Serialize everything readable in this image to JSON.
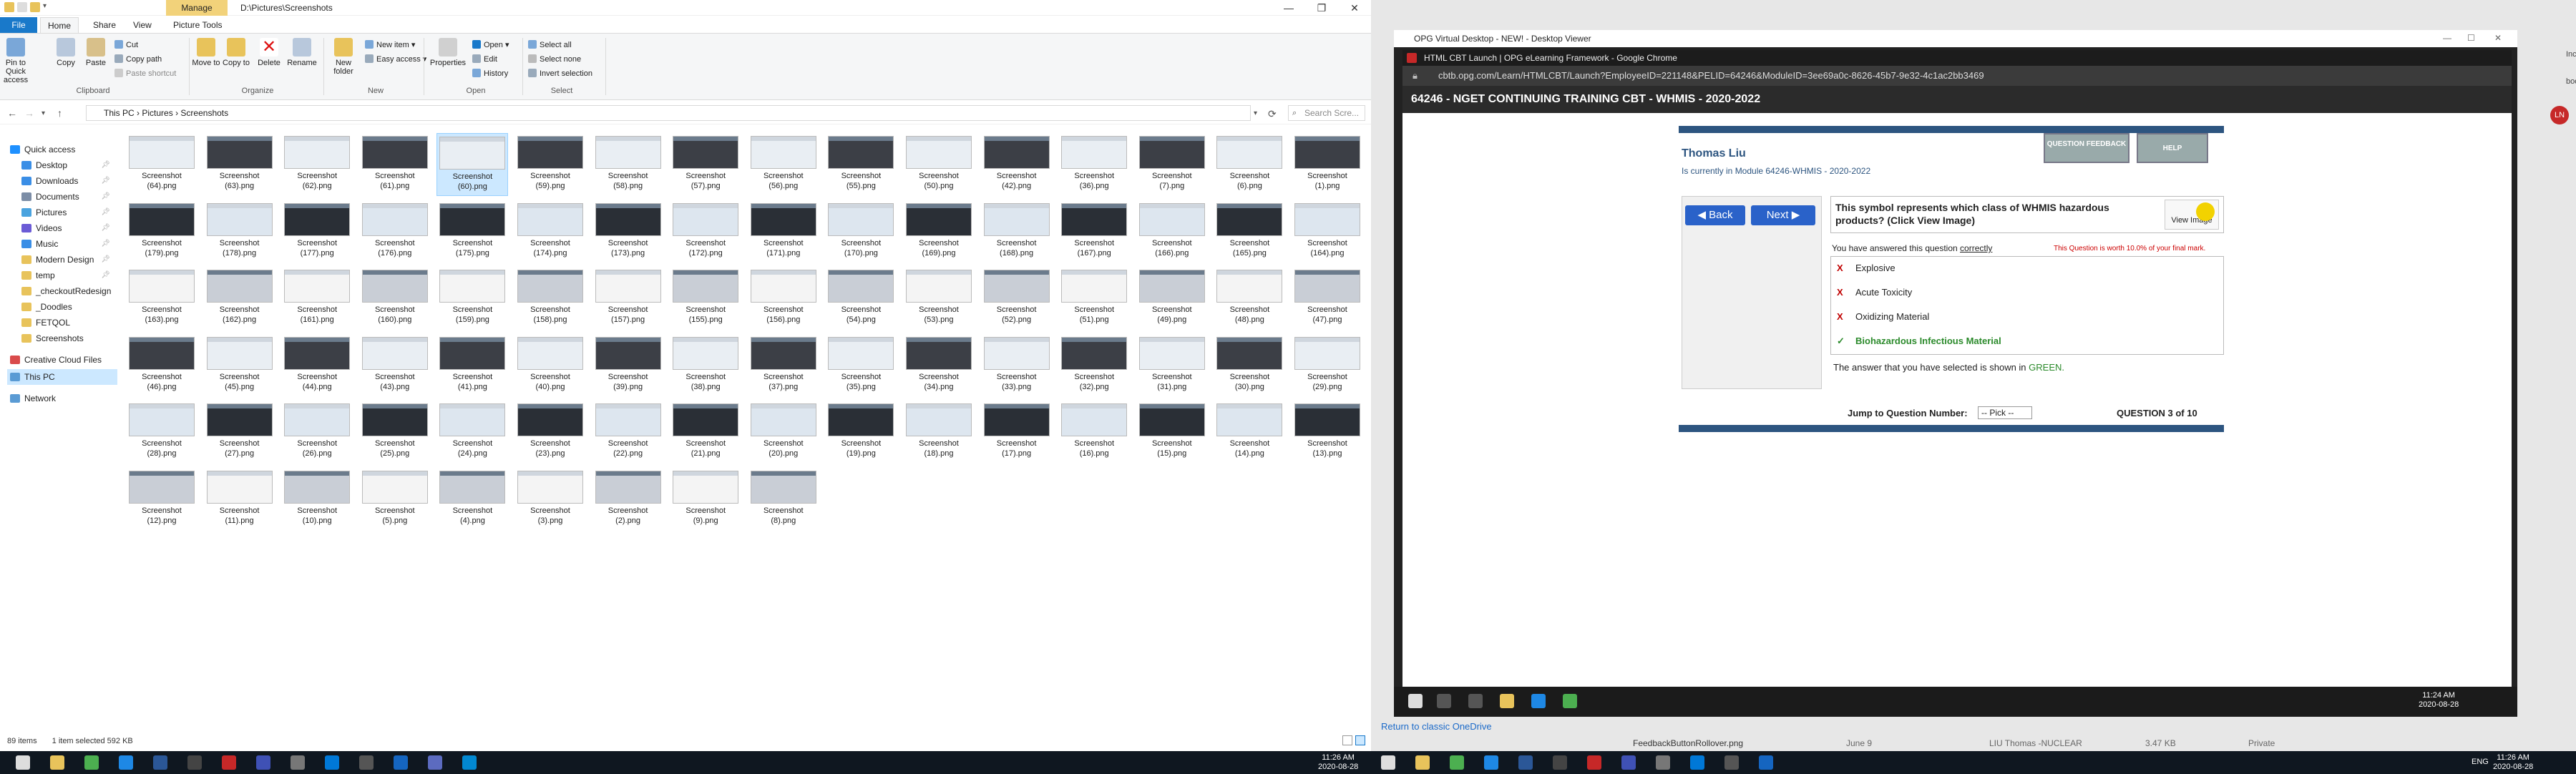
{
  "explorer": {
    "manage_tab": "Manage",
    "path": "D:\\Pictures\\Screenshots",
    "tabs": [
      "File",
      "Home",
      "Share",
      "View",
      "Picture Tools"
    ],
    "ribbon": {
      "pin": "Pin to Quick access",
      "copy": "Copy",
      "paste": "Paste",
      "cut": "Cut",
      "copy_path": "Copy path",
      "paste_shortcut": "Paste shortcut",
      "move_to": "Move to",
      "copy_to": "Copy to",
      "delete": "Delete",
      "rename": "Rename",
      "new_folder": "New folder",
      "new_item": "New item",
      "easy_access": "Easy access",
      "properties": "Properties",
      "open": "Open",
      "edit": "Edit",
      "history": "History",
      "select_all": "Select all",
      "select_none": "Select none",
      "invert_selection": "Invert selection",
      "groups": [
        "Clipboard",
        "Organize",
        "New",
        "Open",
        "Select"
      ]
    },
    "breadcrumb": [
      "This PC",
      "Pictures",
      "Screenshots"
    ],
    "search_placeholder": "Search Scre...",
    "nav": [
      {
        "label": "Quick access",
        "pin": false,
        "color": "#1e90ff"
      },
      {
        "label": "Desktop",
        "pin": true,
        "color": "#3a8ee6"
      },
      {
        "label": "Downloads",
        "pin": true,
        "color": "#3a8ee6"
      },
      {
        "label": "Documents",
        "pin": true,
        "color": "#7c8da6"
      },
      {
        "label": "Pictures",
        "pin": true,
        "color": "#4aa3df"
      },
      {
        "label": "Videos",
        "pin": true,
        "color": "#6b5bd6"
      },
      {
        "label": "Music",
        "pin": true,
        "color": "#3a8ee6"
      },
      {
        "label": "Modern Design",
        "pin": true,
        "color": "#e8c35b"
      },
      {
        "label": "temp",
        "pin": true,
        "color": "#e8c35b"
      },
      {
        "label": "_checkoutRedesign",
        "pin": false,
        "color": "#e8c35b"
      },
      {
        "label": "_Doodles",
        "pin": false,
        "color": "#e8c35b"
      },
      {
        "label": "FETQOL",
        "pin": false,
        "color": "#e8c35b"
      },
      {
        "label": "Screenshots",
        "pin": false,
        "color": "#e8c35b"
      },
      {
        "label": "Creative Cloud Files",
        "pin": false,
        "color": "#d94b4b"
      },
      {
        "label": "This PC",
        "pin": false,
        "color": "#5a9bd4"
      },
      {
        "label": "Network",
        "pin": false,
        "color": "#5a9bd4"
      }
    ],
    "files": [
      [
        "(64)",
        "(63)",
        "(62)",
        "(61)",
        "(60)",
        "(59)",
        "(58)",
        "(57)",
        "(56)",
        "(55)",
        "(50)",
        "(42)",
        "(36)",
        "(7)",
        "(6)",
        "(1)"
      ],
      [
        "(179)",
        "(178)",
        "(177)",
        "(176)",
        "(175)",
        "(174)",
        "(173)",
        "(172)",
        "(171)",
        "(170)",
        "(169)",
        "(168)",
        "(167)",
        "(166)",
        "(165)",
        "(164)"
      ],
      [
        "(163)",
        "(162)",
        "(161)",
        "(160)",
        "(159)",
        "(158)",
        "(157)",
        "(155)",
        "(156)",
        "(54)",
        "(53)",
        "(52)",
        "(51)",
        "(49)",
        "(48)",
        "(47)"
      ],
      [
        "(46)",
        "(45)",
        "(44)",
        "(43)",
        "(41)",
        "(40)",
        "(39)",
        "(38)",
        "(37)",
        "(35)",
        "(34)",
        "(33)",
        "(32)",
        "(31)",
        "(30)",
        "(29)"
      ],
      [
        "(28)",
        "(27)",
        "(26)",
        "(25)",
        "(24)",
        "(23)",
        "(22)",
        "(21)",
        "(20)",
        "(19)",
        "(18)",
        "(17)",
        "(16)",
        "(15)",
        "(14)",
        "(13)"
      ],
      [
        "(12)",
        "(11)",
        "(10)",
        "(5)",
        "(4)",
        "(3)",
        "(2)",
        "(9)",
        "(8)"
      ]
    ],
    "file_prefix": "Screenshot",
    "file_ext": ".png",
    "selected_file": "(60)",
    "status": {
      "count": "89 items",
      "selection": "1 item selected  592 KB"
    }
  },
  "right": {
    "vd_title": "OPG Virtual Desktop - NEW! - Desktop Viewer",
    "chrome_title": "HTML CBT Launch | OPG eLearning Framework - Google Chrome",
    "url": "cbtb.opg.com/Learn/HTMLCBT/Launch?EmployeeID=221148&PELID=64246&ModuleID=3ee69a0c-8626-45b7-9e32-4c1ac2bb3469",
    "page_header": "64246 - NGET CONTINUING TRAINING CBT - WHMIS - 2020-2022",
    "student": "Thomas Liu",
    "module": "Is currently in Module 64246-WHMIS - 2020-2022",
    "question_feedback": "QUESTION FEEDBACK",
    "help": "HELP",
    "back": "Back",
    "next": "Next",
    "question": "This symbol represents which class of WHMIS hazardous products? (Click View Image)",
    "view_image": "View Image",
    "answered": "You have answered this question",
    "answered_status": "correctly",
    "worth": "This Question is worth 10.0% of your final mark.",
    "answers": [
      {
        "label": "Explosive",
        "mark": "X",
        "correct": false
      },
      {
        "label": "Acute Toxicity",
        "mark": "X",
        "correct": false
      },
      {
        "label": "Oxidizing Material",
        "mark": "X",
        "correct": false
      },
      {
        "label": "Biohazardous Infectious Material",
        "mark": "✓",
        "correct": true
      }
    ],
    "shown_text": "The answer that you have selected is shown in",
    "shown_color_word": "GREEN.",
    "jump_label": "Jump to Question Number:",
    "jump_select": "-- Pick --",
    "question_number": "QUESTION 3 of 10",
    "vd_time": "11:24 AM",
    "vd_date": "2020-08-28",
    "return_link": "Return to classic OneDrive",
    "bg_row_name": "FeedbackButtonRollover.png",
    "bg_row_date": "June 9",
    "bg_row_owner": "LIU Thomas -NUCLEAR",
    "bg_row_size": "3.47 KB",
    "bg_row_sharing": "Private",
    "incognito": "Incognito",
    "bookmarks": "bookmarks",
    "avatar": "LN"
  },
  "taskbar": {
    "time_left": "11:26 AM",
    "date_left": "2020-08-28",
    "time_right": "11:26 AM",
    "date_right": "2020-08-28",
    "lang": "ENG"
  },
  "colors": {
    "accent": "#1979ca",
    "cbt_blue": "#2d5580",
    "correct_green": "#2b8a2b",
    "wrong_red": "#c00000"
  }
}
